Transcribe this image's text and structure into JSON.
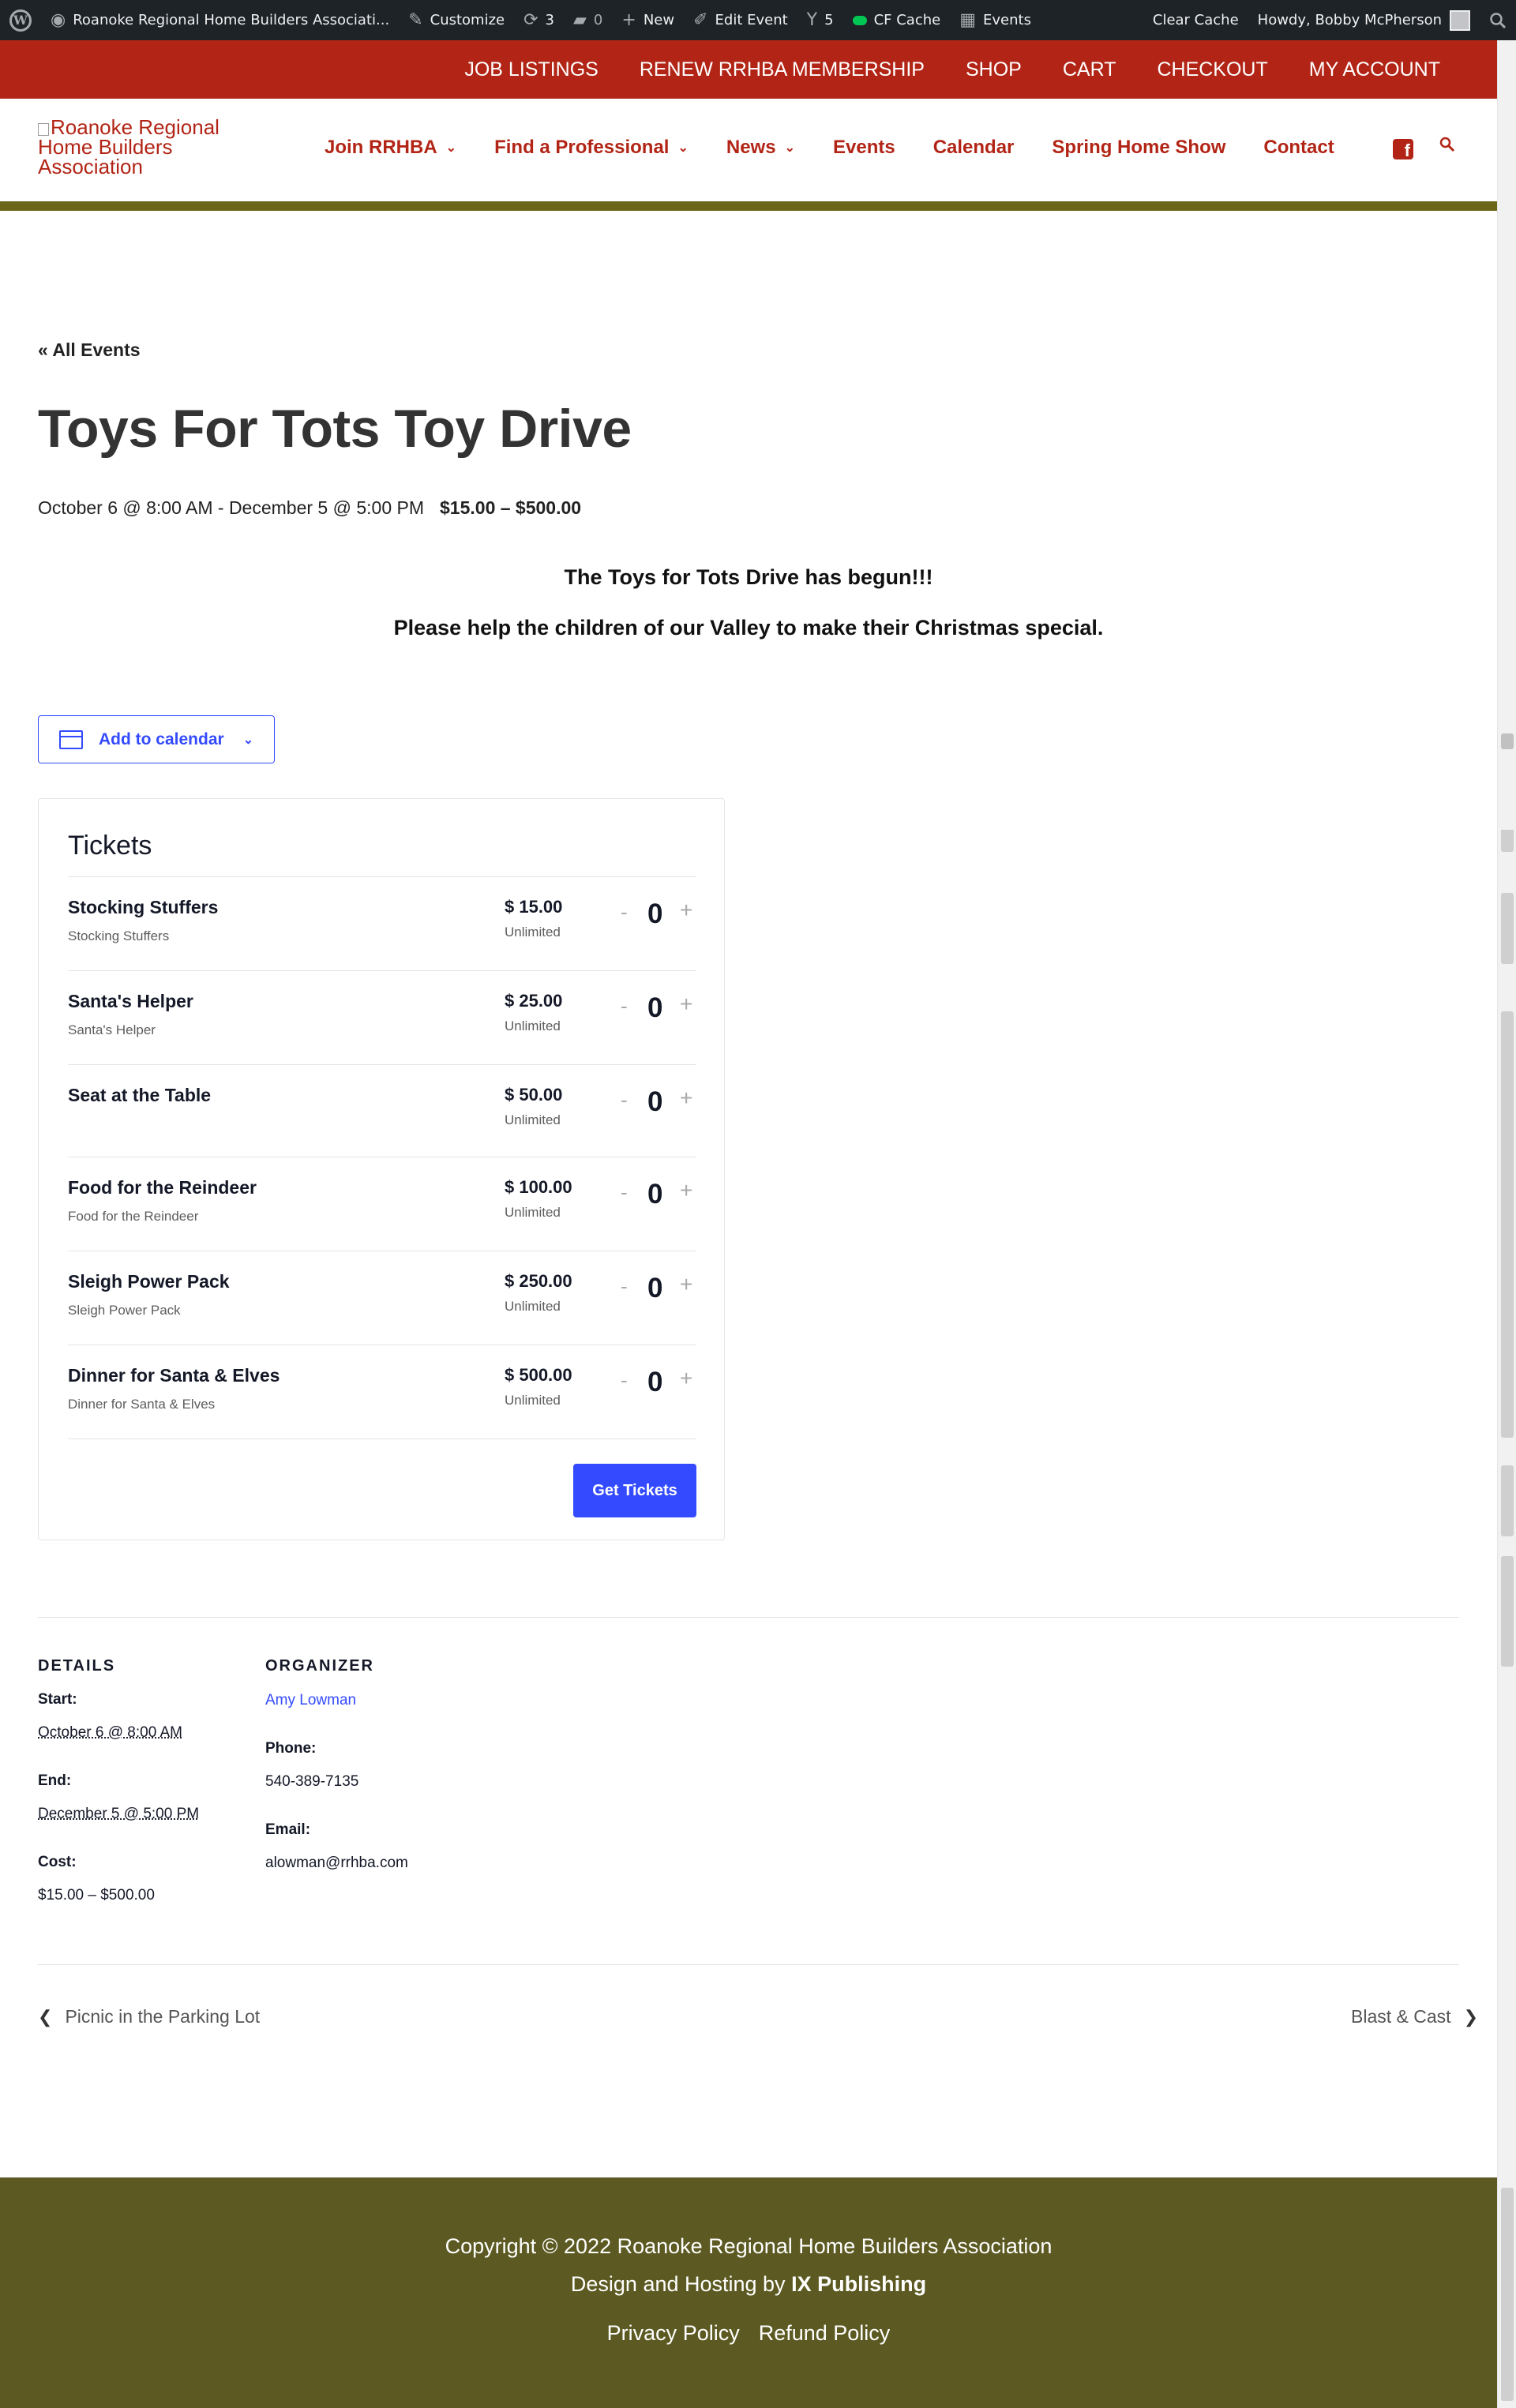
{
  "adminbar": {
    "site_name": "Roanoke Regional Home Builders Associati...",
    "customize": "Customize",
    "updates": "3",
    "comments": "0",
    "new": "New",
    "edit_event": "Edit Event",
    "yoast_count": "5",
    "cf_cache": "CF Cache",
    "events": "Events",
    "clear_cache": "Clear Cache",
    "howdy": "Howdy, Bobby McPherson"
  },
  "topbar": {
    "links": [
      "JOB LISTINGS",
      "RENEW RRHBA MEMBERSHIP",
      "SHOP",
      "CART",
      "CHECKOUT",
      "MY ACCOUNT"
    ]
  },
  "header": {
    "logo_alt": "Roanoke Regional Home Builders Association",
    "nav": [
      "Join RRHBA",
      "Find a Professional",
      "News",
      "Events",
      "Calendar",
      "Spring Home Show",
      "Contact"
    ]
  },
  "event": {
    "back_link": "« All Events",
    "title": "Toys For Tots Toy Drive",
    "schedule": "October 6 @ 8:00 AM - December 5 @ 5:00 PM",
    "cost": "$15.00 – $500.00",
    "desc_line1": "The Toys for Tots Drive has begun!!!",
    "desc_line2": "Please help the children of our Valley to make their Christmas special.",
    "add_to_calendar": "Add to calendar"
  },
  "tickets": {
    "heading": "Tickets",
    "items": [
      {
        "name": "Stocking Stuffers",
        "desc": "Stocking Stuffers",
        "price": "$ 15.00",
        "stock": "Unlimited",
        "qty": "0"
      },
      {
        "name": "Santa's Helper",
        "desc": "Santa's Helper",
        "price": "$ 25.00",
        "stock": "Unlimited",
        "qty": "0"
      },
      {
        "name": "Seat at the Table",
        "desc": "",
        "price": "$ 50.00",
        "stock": "Unlimited",
        "qty": "0"
      },
      {
        "name": "Food for the Reindeer",
        "desc": "Food for the Reindeer",
        "price": "$ 100.00",
        "stock": "Unlimited",
        "qty": "0"
      },
      {
        "name": "Sleigh Power Pack",
        "desc": "Sleigh Power Pack",
        "price": "$ 250.00",
        "stock": "Unlimited",
        "qty": "0"
      },
      {
        "name": "Dinner for Santa & Elves",
        "desc": "Dinner for Santa & Elves",
        "price": "$ 500.00",
        "stock": "Unlimited",
        "qty": "0"
      }
    ],
    "minus": "-",
    "plus": "+",
    "button": "Get Tickets"
  },
  "details": {
    "heading": "DETAILS",
    "start_label": "Start:",
    "start": "October 6 @ 8:00 AM",
    "end_label": "End:",
    "end": "December 5 @ 5:00 PM",
    "cost_label": "Cost:",
    "cost": "$15.00 – $500.00"
  },
  "organizer": {
    "heading": "ORGANIZER",
    "name": "Amy Lowman",
    "phone_label": "Phone:",
    "phone": "540-389-7135",
    "email_label": "Email:",
    "email": "alowman@rrhba.com"
  },
  "navigation": {
    "prev": "Picnic in the Parking Lot",
    "next": "Blast & Cast"
  },
  "footer": {
    "copyright": "Copyright © 2022 Roanoke Regional Home Builders Association",
    "design_prefix": "Design and Hosting by",
    "design_company": "IX Publishing",
    "privacy": "Privacy Policy",
    "refund": "Refund Policy"
  },
  "colors": {
    "brand_red": "#b22516",
    "olive": "#6b6518",
    "footer_bg": "#5c5a22",
    "accent_blue": "#334aff"
  }
}
